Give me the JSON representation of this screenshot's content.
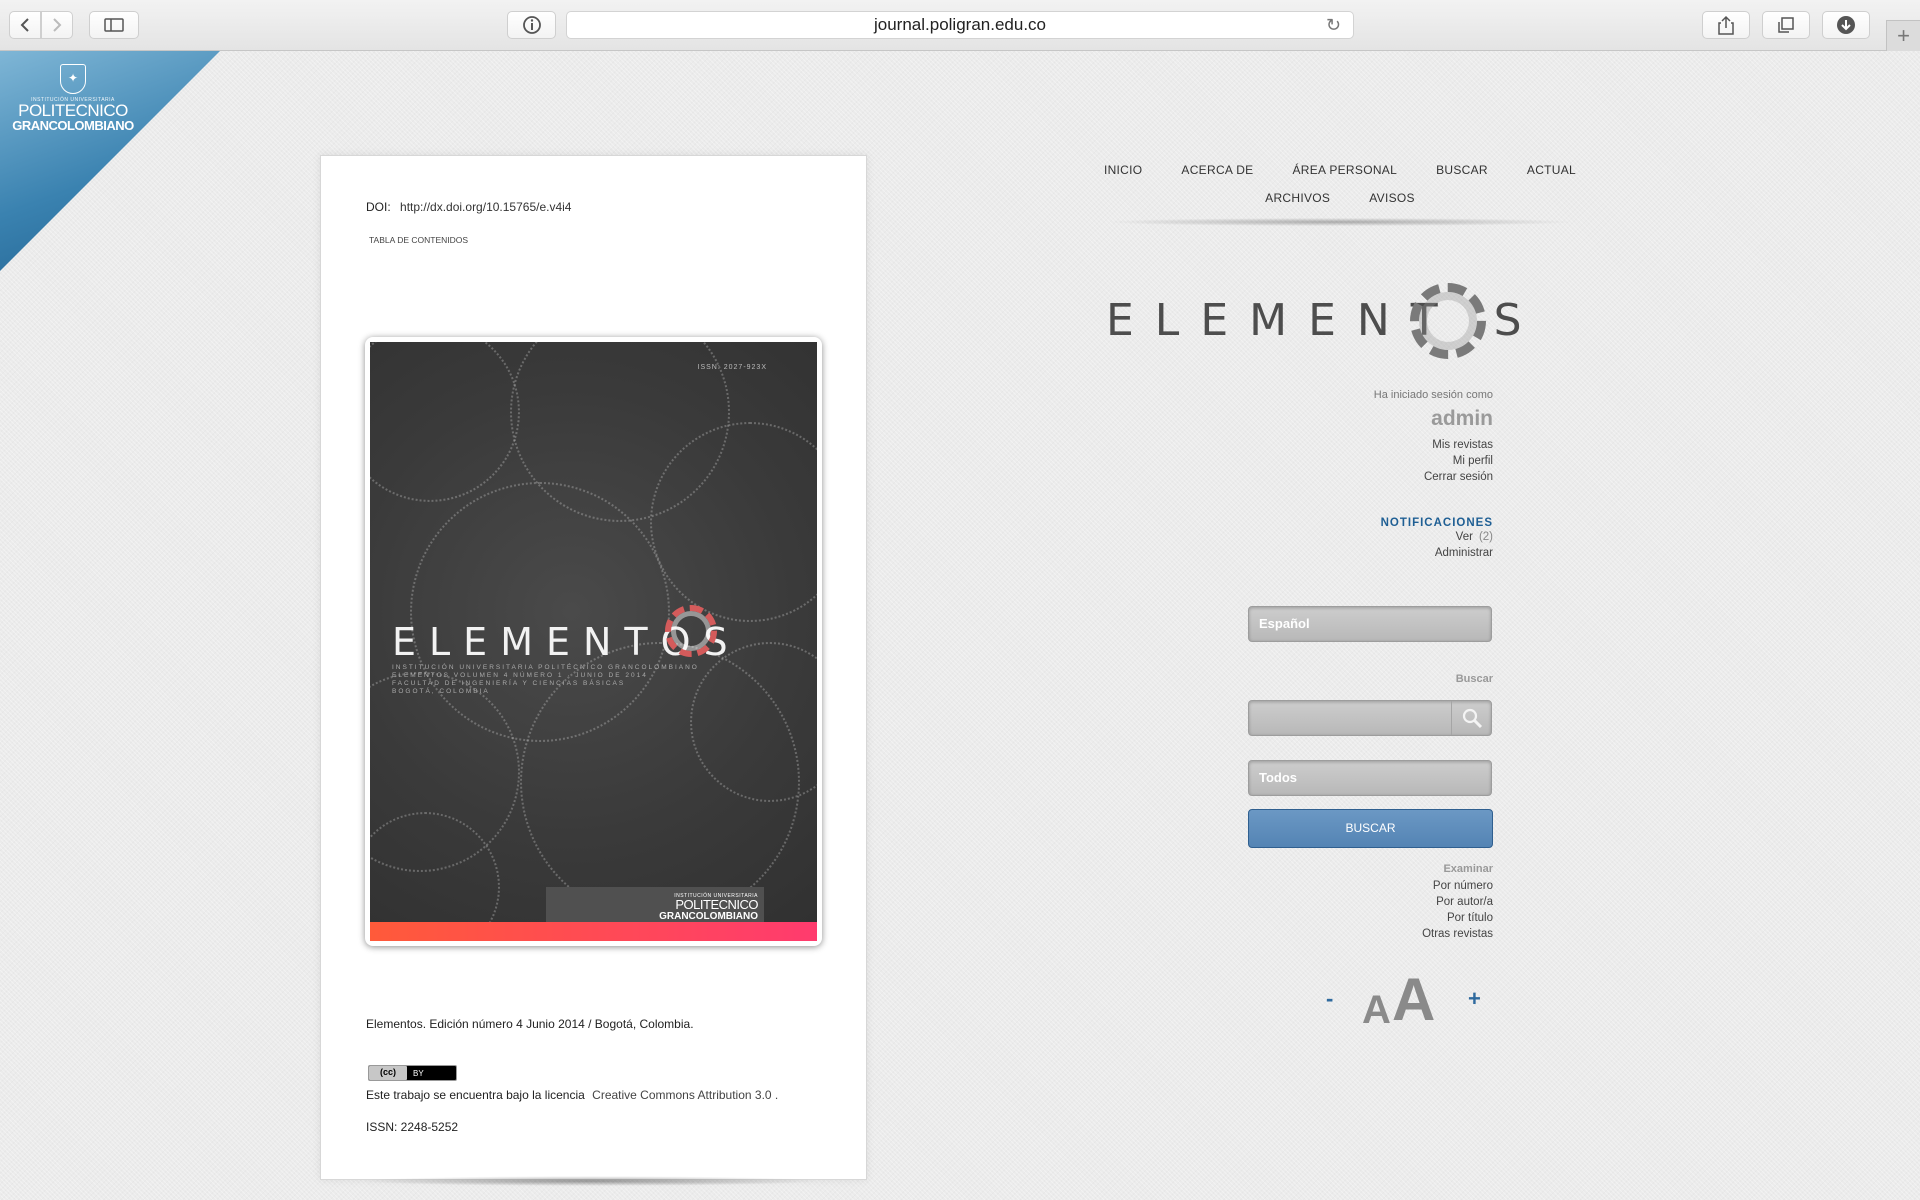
{
  "browser": {
    "url": "journal.poligran.edu.co",
    "back_icon": "chevron-left-icon",
    "forward_icon": "chevron-right-icon",
    "sidebar_icon": "sidebar-icon",
    "info_icon": "info-icon",
    "reload_icon": "reload-icon",
    "share_icon": "share-icon",
    "tabs_icon": "tabs-icon",
    "download_icon": "download-icon",
    "new_tab_icon": "plus-icon"
  },
  "corner_logo": {
    "subtitle": "INSTITUCIÓN UNIVERSITARIA",
    "line1": "POLITECNICO",
    "line2": "GRANCOLOMBIANO",
    "gradient_colors": [
      "#7fb6d6",
      "#1e5f8e"
    ]
  },
  "article": {
    "doi_label": "DOI:",
    "doi_url": "http://dx.doi.org/10.15765/e.v4i4",
    "toc_link": "TABLA DE CONTENIDOS",
    "cover": {
      "issn": "ISSN: 2027-923X",
      "title": "ELEMENTOS",
      "sub1": "INSTITUCIÓN UNIVERSITARIA POLITÉCNICO GRANCOLOMBIANO",
      "sub2": "ELEMENTOS VOLUMEN 4 NÚMERO 1 · JUNIO DE 2014",
      "sub3": "FACULTAD DE INGENIERÍA Y CIENCIAS BÁSICAS",
      "sub4": "BOGOTÁ, COLOMBIA",
      "badge_sub": "INSTITUCIÓN UNIVERSITARIA",
      "badge_l1": "POLITECNICO",
      "badge_l2": "GRANCOLOMBIANO"
    },
    "edition": "Elementos. Edición número 4 Junio 2014 / Bogotá, Colombia.",
    "cc_left": "(cc)",
    "cc_right": "BY",
    "license_text": "Este trabajo se encuentra bajo la licencia",
    "license_link": "Creative Commons Attribution 3.0 .",
    "issn": "ISSN: 2248-5252"
  },
  "nav": {
    "items_row1": [
      "INICIO",
      "ACERCA DE",
      "ÁREA PERSONAL",
      "BUSCAR",
      "ACTUAL"
    ],
    "items_row2": [
      "ARCHIVOS",
      "AVISOS"
    ]
  },
  "brand": {
    "title": "ELEMENT S"
  },
  "user": {
    "logged_in_as": "Ha iniciado sesión como",
    "username": "admin",
    "links": [
      "Mis revistas",
      "Mi perfil",
      "Cerrar sesión"
    ]
  },
  "notifications": {
    "title": "NOTIFICACIONES",
    "view_label": "Ver",
    "view_count": "(2)",
    "manage_label": "Administrar",
    "title_color": "#1f5f94"
  },
  "sidebar_search": {
    "language_value": "Español",
    "search_label": "Buscar",
    "search_value": "",
    "scope_value": "Todos",
    "submit_label": "BUSCAR",
    "submit_color": "#5a8abb"
  },
  "browse": {
    "title": "Examinar",
    "links": [
      "Por número",
      "Por autor/a",
      "Por título",
      "Otras revistas"
    ]
  },
  "font_size": {
    "decrease": "-",
    "small_a": "A",
    "large_a": "A",
    "increase": "+"
  }
}
